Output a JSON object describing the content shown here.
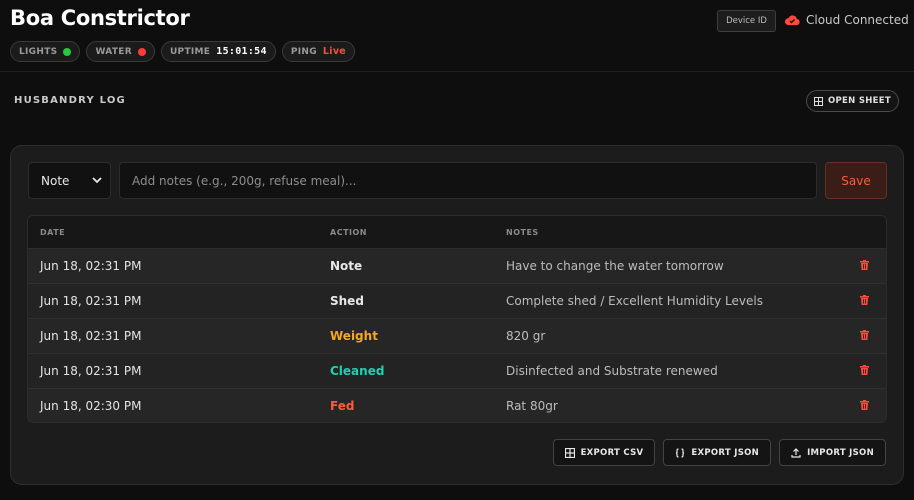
{
  "header": {
    "title": "Boa Constrictor",
    "device_id_label": "Device ID",
    "cloud_status": "Cloud Connected",
    "pills": {
      "lights": {
        "label": "LIGHTS",
        "status_color": "#27c93f"
      },
      "water": {
        "label": "WATER",
        "status_color": "#ff3b3b"
      },
      "uptime": {
        "label": "UPTIME",
        "value": "15:01:54"
      },
      "ping": {
        "label": "PING",
        "value": "Live"
      }
    }
  },
  "log": {
    "section_title": "HUSBANDRY LOG",
    "open_sheet_label": "OPEN SHEET",
    "select_value": "Note",
    "notes_placeholder": "Add notes (e.g., 200g, refuse meal)...",
    "save_label": "Save",
    "columns": {
      "date": "DATE",
      "action": "ACTION",
      "notes": "NOTES"
    },
    "rows": [
      {
        "date": "Jun 18, 02:31 PM",
        "action": "Note",
        "action_color": "#e8e8e8",
        "notes": "Have to change the water tomorrow"
      },
      {
        "date": "Jun 18, 02:31 PM",
        "action": "Shed",
        "action_color": "#e8e8e8",
        "notes": "Complete shed / Excellent Humidity Levels"
      },
      {
        "date": "Jun 18, 02:31 PM",
        "action": "Weight",
        "action_color": "#f5a623",
        "notes": "820 gr"
      },
      {
        "date": "Jun 18, 02:31 PM",
        "action": "Cleaned",
        "action_color": "#1fd1b2",
        "notes": "Disinfected and Substrate renewed"
      },
      {
        "date": "Jun 18, 02:30 PM",
        "action": "Fed",
        "action_color": "#ff5a3d",
        "notes": "Rat 80gr"
      }
    ],
    "export_csv_label": "EXPORT CSV",
    "export_json_label": "EXPORT JSON",
    "import_json_label": "IMPORT JSON"
  },
  "colors": {
    "accent_red": "#ff4a3d",
    "background": "#0e0e0e",
    "panel": "#1c1c1c"
  }
}
